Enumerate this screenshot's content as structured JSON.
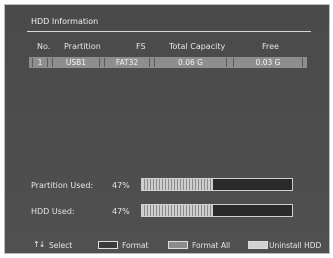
{
  "window": {
    "title": "HDD Information"
  },
  "table": {
    "headers": [
      "No.",
      "Prartition",
      "FS",
      "Total Capacity",
      "Free"
    ],
    "rows": [
      {
        "no": "1",
        "partition": "USB1",
        "fs": "FAT32",
        "total": "0.06  G",
        "free": "0.03  G"
      }
    ]
  },
  "usage": {
    "partition": {
      "label": "Prartition Used:",
      "percent_text": "47%",
      "fraction": 0.47
    },
    "hdd": {
      "label": "HDD Used:",
      "percent_text": "47%",
      "fraction": 0.47
    }
  },
  "footer": {
    "select_icon": "up-down-arrows",
    "select_label": "Select",
    "format_label": "Format",
    "format_all_label": "Format All",
    "uninstall_label": "Uninstall HDD",
    "colors": {
      "format": "#3a3a3a",
      "format_all": "#8c8c8c",
      "uninstall": "#d2d2d2"
    }
  }
}
